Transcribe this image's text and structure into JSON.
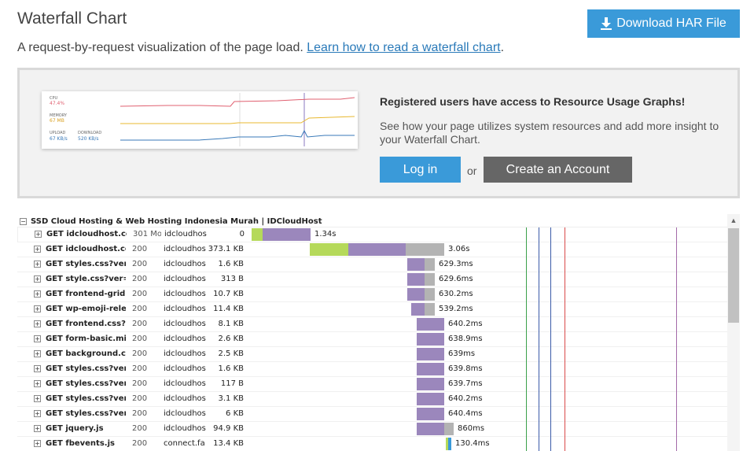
{
  "header": {
    "title": "Waterfall Chart",
    "download_label": "Download HAR File",
    "download_icon": "download-icon",
    "subtitle": "A request-by-request visualization of the page load.",
    "learn_link": "Learn how to read a waterfall chart",
    "subtitle_end": "."
  },
  "promo": {
    "graph": {
      "cpu_label": "CPU",
      "cpu_value": "47.4%",
      "memory_label": "MEMORY",
      "memory_value": "67 MB",
      "upload_label": "UPLOAD",
      "upload_value": "67 KB/s",
      "download_label": "DOWNLOAD",
      "download_value": "520 KB/s",
      "colors": {
        "cpu": "#e06070",
        "memory": "#e8b830",
        "upload": "#3a7ab9",
        "download": "#3a7ab9"
      }
    },
    "heading": "Registered users have access to Resource Usage Graphs!",
    "text": "See how your page utilizes system resources and add more insight to your Waterfall Chart.",
    "login_label": "Log in",
    "or_label": "or",
    "create_label": "Create an Account"
  },
  "waterfall": {
    "page_title": "SSD Cloud Hosting & Web Hosting Indonesia Murah | IDCloudHost",
    "expander_symbol": "+",
    "collapse_symbol": "−",
    "colors": {
      "wait": "#9b87bc",
      "connect": "#b5d95a",
      "receive": "#b3b3b3",
      "blocked": "#3a9ad9",
      "line_green": "#3aa04a",
      "line_blue": "#3a5aa8",
      "line_red": "#d94a4a",
      "line_purple": "#a36aa8"
    },
    "rows": [
      {
        "request": "GET idcloudhost.co",
        "status": "301 Mo",
        "domain": "idcloudhost",
        "size": "0",
        "time": "1.34s",
        "segments": [
          {
            "type": "connect",
            "start": 319,
            "width": 14
          },
          {
            "type": "wait",
            "start": 333,
            "width": 61
          }
        ]
      },
      {
        "request": "GET idcloudhost.co",
        "status": "200",
        "domain": "idcloudhost",
        "size": "373.1 KB",
        "time": "3.06s",
        "segments": [
          {
            "type": "connect",
            "start": 394,
            "width": 49
          },
          {
            "type": "wait",
            "start": 443,
            "width": 73
          },
          {
            "type": "receive",
            "start": 516,
            "width": 49
          }
        ]
      },
      {
        "request": "GET styles.css?ver",
        "status": "200",
        "domain": "idcloudhost",
        "size": "1.6 KB",
        "time": "629.3ms",
        "segments": [
          {
            "type": "wait",
            "start": 518,
            "width": 22
          },
          {
            "type": "receive",
            "start": 540,
            "width": 13
          }
        ]
      },
      {
        "request": "GET style.css?ver=",
        "status": "200",
        "domain": "idcloudhost",
        "size": "313 B",
        "time": "629.6ms",
        "segments": [
          {
            "type": "wait",
            "start": 518,
            "width": 22
          },
          {
            "type": "receive",
            "start": 540,
            "width": 13
          }
        ]
      },
      {
        "request": "GET frontend-grid.",
        "status": "200",
        "domain": "idcloudhost",
        "size": "10.7 KB",
        "time": "630.2ms",
        "segments": [
          {
            "type": "wait",
            "start": 518,
            "width": 22
          },
          {
            "type": "receive",
            "start": 540,
            "width": 13
          }
        ]
      },
      {
        "request": "GET wp-emoji-rele",
        "status": "200",
        "domain": "idcloudhost",
        "size": "11.4 KB",
        "time": "539.2ms",
        "segments": [
          {
            "type": "wait",
            "start": 523,
            "width": 17
          },
          {
            "type": "receive",
            "start": 540,
            "width": 13
          }
        ]
      },
      {
        "request": "GET frontend.css?",
        "status": "200",
        "domain": "idcloudhost",
        "size": "8.1 KB",
        "time": "640.2ms",
        "segments": [
          {
            "type": "wait",
            "start": 530,
            "width": 35
          }
        ]
      },
      {
        "request": "GET form-basic.mi",
        "status": "200",
        "domain": "idcloudhost",
        "size": "2.6 KB",
        "time": "638.9ms",
        "segments": [
          {
            "type": "wait",
            "start": 530,
            "width": 35
          }
        ]
      },
      {
        "request": "GET background.c:",
        "status": "200",
        "domain": "idcloudhost",
        "size": "2.5 KB",
        "time": "639ms",
        "segments": [
          {
            "type": "wait",
            "start": 530,
            "width": 35
          }
        ]
      },
      {
        "request": "GET styles.css?ver",
        "status": "200",
        "domain": "idcloudhost",
        "size": "1.6 KB",
        "time": "639.8ms",
        "segments": [
          {
            "type": "wait",
            "start": 530,
            "width": 35
          }
        ]
      },
      {
        "request": "GET styles.css?ver",
        "status": "200",
        "domain": "idcloudhost",
        "size": "117 B",
        "time": "639.7ms",
        "segments": [
          {
            "type": "wait",
            "start": 530,
            "width": 35
          }
        ]
      },
      {
        "request": "GET styles.css?ver",
        "status": "200",
        "domain": "idcloudhost",
        "size": "3.1 KB",
        "time": "640.2ms",
        "segments": [
          {
            "type": "wait",
            "start": 530,
            "width": 35
          }
        ]
      },
      {
        "request": "GET styles.css?ver",
        "status": "200",
        "domain": "idcloudhost",
        "size": "6 KB",
        "time": "640.4ms",
        "segments": [
          {
            "type": "wait",
            "start": 530,
            "width": 35
          }
        ]
      },
      {
        "request": "GET jquery.js",
        "status": "200",
        "domain": "idcloudhost",
        "size": "94.9 KB",
        "time": "860ms",
        "segments": [
          {
            "type": "wait",
            "start": 530,
            "width": 35
          },
          {
            "type": "receive",
            "start": 565,
            "width": 12
          }
        ]
      },
      {
        "request": "GET fbevents.js",
        "status": "200",
        "domain": "connect.fa",
        "size": "13.4 KB",
        "time": "130.4ms",
        "segments": [
          {
            "type": "connect",
            "start": 567,
            "width": 3
          },
          {
            "type": "blocked",
            "start": 570,
            "width": 4
          }
        ]
      }
    ],
    "scroll_up_symbol": "▲"
  }
}
